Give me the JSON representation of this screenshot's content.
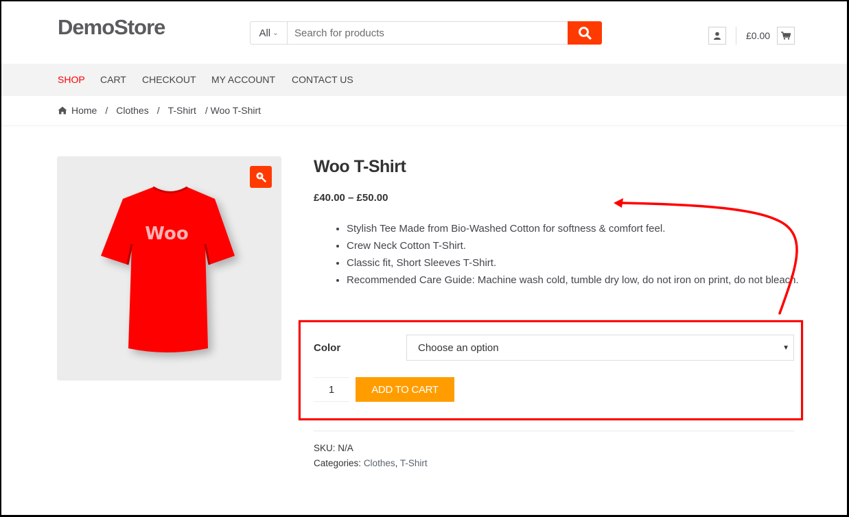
{
  "header": {
    "logo": "DemoStore",
    "search": {
      "category": "All",
      "placeholder": "Search for products",
      "value": ""
    },
    "cart_total": "£0.00",
    "icons": {
      "search": "search-icon",
      "account": "user-icon",
      "cart": "cart-icon"
    }
  },
  "nav": {
    "items": [
      {
        "label": "SHOP",
        "active": true
      },
      {
        "label": "CART",
        "active": false
      },
      {
        "label": "CHECKOUT",
        "active": false
      },
      {
        "label": "MY ACCOUNT",
        "active": false
      },
      {
        "label": "CONTACT US",
        "active": false
      }
    ]
  },
  "breadcrumb": {
    "items": [
      "Home",
      "Clothes",
      "T-Shirt"
    ],
    "current": "/ Woo T-Shirt",
    "separator": "/"
  },
  "product": {
    "image_label": "Woo",
    "title": "Woo T-Shirt",
    "price": "£40.00 – £50.00",
    "description": [
      "Stylish Tee Made from Bio-Washed Cotton for softness & comfort feel.",
      "Crew Neck Cotton T-Shirt.",
      "Classic fit, Short Sleeves T-Shirt.",
      "Recommended Care Guide: Machine wash cold, tumble dry low, do not iron on print, do not bleach."
    ],
    "variation": {
      "label": "Color",
      "selected": "Choose an option"
    },
    "quantity": "1",
    "add_to_cart_label": "ADD TO CART",
    "sku_label": "SKU:",
    "sku_value": "N/A",
    "categories_label": "Categories:",
    "categories": [
      "Clothes",
      "T-Shirt"
    ]
  },
  "colors": {
    "accent": "#ff3a00",
    "nav_active": "#ff0000",
    "add_to_cart": "#ff9d00",
    "annotation": "#ff0000",
    "nav_bg": "#f3f3f3",
    "image_bg": "#ececec"
  }
}
